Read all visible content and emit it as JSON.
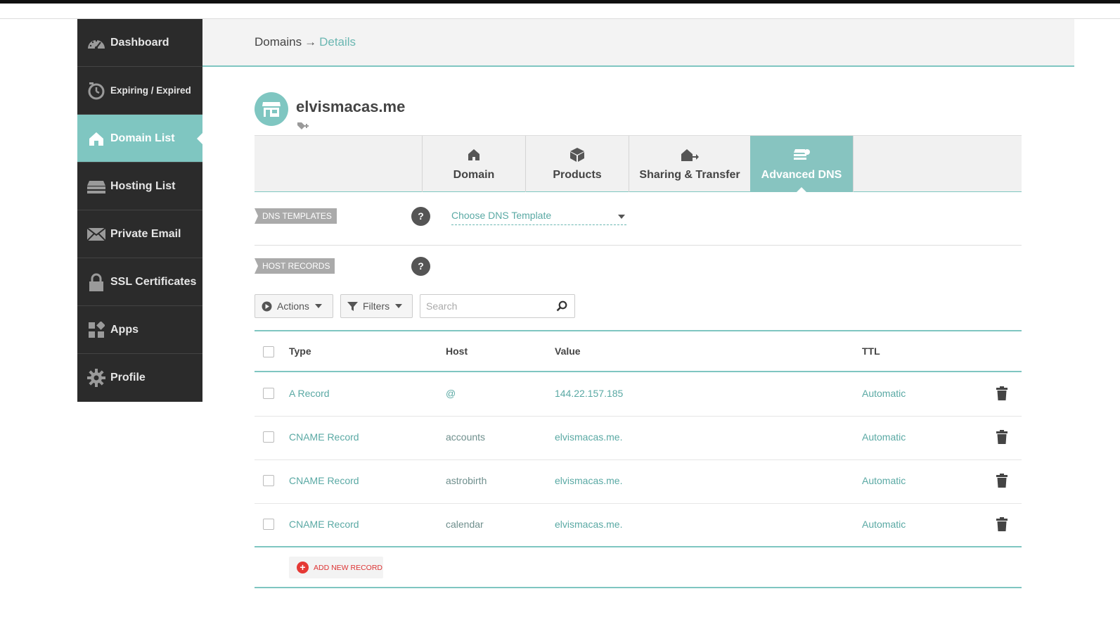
{
  "sidebar": {
    "items": [
      {
        "label": "Dashboard",
        "icon": "speedometer-icon",
        "active": false
      },
      {
        "label": "Expiring / Expired",
        "icon": "clock-icon",
        "active": false
      },
      {
        "label": "Domain List",
        "icon": "home-icon",
        "active": true
      },
      {
        "label": "Hosting List",
        "icon": "server-icon",
        "active": false
      },
      {
        "label": "Private Email",
        "icon": "envelope-icon",
        "active": false
      },
      {
        "label": "SSL Certificates",
        "icon": "lock-icon",
        "active": false
      },
      {
        "label": "Apps",
        "icon": "apps-icon",
        "active": false
      },
      {
        "label": "Profile",
        "icon": "gear-icon",
        "active": false
      }
    ]
  },
  "header": {
    "breadcrumb_root": "Domains",
    "breadcrumb_sep": "→",
    "breadcrumb_current": "Details"
  },
  "domain": {
    "name": "elvismacas.me"
  },
  "tabs": [
    {
      "label": "Domain",
      "icon": "home-icon",
      "active": false
    },
    {
      "label": "Products",
      "icon": "box-icon",
      "active": false
    },
    {
      "label": "Sharing & Transfer",
      "icon": "transfer-icon",
      "active": false
    },
    {
      "label": "Advanced DNS",
      "icon": "dns-icon",
      "active": true
    }
  ],
  "dns_templates": {
    "label": "DNS TEMPLATES",
    "help": "?",
    "select_value": "Choose DNS Template"
  },
  "host_records": {
    "label": "HOST RECORDS",
    "help": "?"
  },
  "toolbar": {
    "actions_label": "Actions",
    "filters_label": "Filters",
    "search_placeholder": "Search"
  },
  "table": {
    "columns": [
      "Type",
      "Host",
      "Value",
      "TTL"
    ],
    "rows": [
      {
        "type": "A Record",
        "host": "@",
        "value": "144.22.157.185",
        "ttl": "Automatic"
      },
      {
        "type": "CNAME Record",
        "host": "accounts",
        "value": "elvismacas.me.",
        "ttl": "Automatic"
      },
      {
        "type": "CNAME Record",
        "host": "astrobirth",
        "value": "elvismacas.me.",
        "ttl": "Automatic"
      },
      {
        "type": "CNAME Record",
        "host": "calendar",
        "value": "elvismacas.me.",
        "ttl": "Automatic"
      }
    ]
  },
  "add_record_label": "ADD NEW RECORD",
  "colors": {
    "accent": "#7fc6c1",
    "sidebar_bg": "#2b2b2b",
    "link": "#5aa9a4",
    "danger": "#e53935"
  }
}
